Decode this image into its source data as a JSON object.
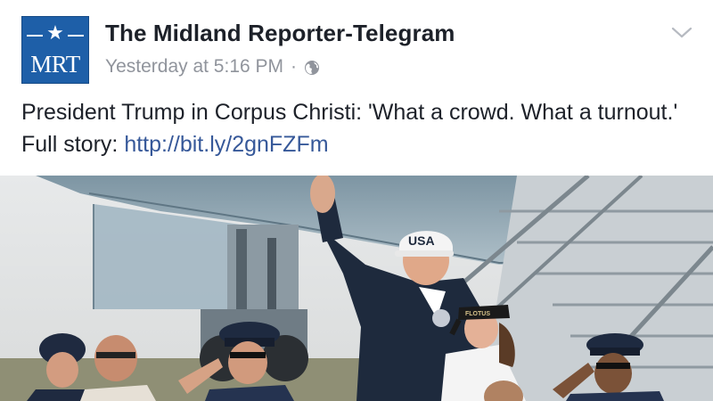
{
  "post": {
    "page_name": "The Midland Reporter-Telegram",
    "timestamp": "Yesterday at 5:16 PM",
    "separator": "·",
    "privacy_icon": "globe-icon",
    "menu_icon": "chevron-down-icon",
    "avatar": {
      "initials": "MRT",
      "star": "★",
      "color": "#1e5fa8"
    },
    "text": "President Trump in Corpus Christi: 'What a crowd. What a turnout.' Full story:",
    "link": "http://bit.ly/2gnFZFm",
    "photo": {
      "cap_text_1": "USA",
      "cap_text_2": "FLOTUS"
    }
  },
  "colors": {
    "name": "#1d2129",
    "meta": "#90949c",
    "link": "#365899"
  }
}
